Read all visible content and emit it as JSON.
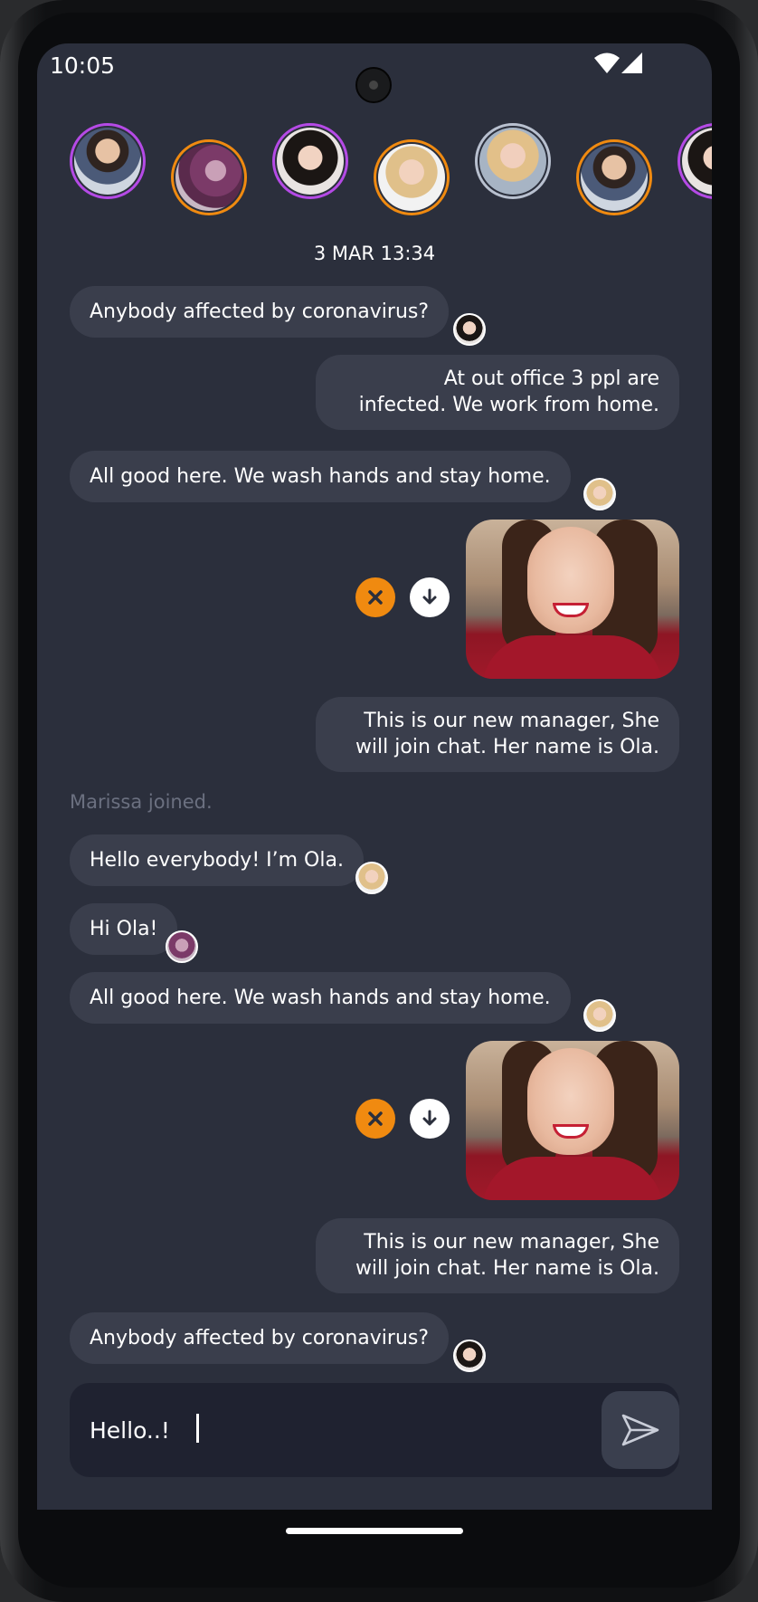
{
  "status": {
    "time": "10:05"
  },
  "stories": [
    {
      "name": "story-1",
      "ring": "purple"
    },
    {
      "name": "story-2",
      "ring": "orange"
    },
    {
      "name": "story-3",
      "ring": "purple"
    },
    {
      "name": "story-4",
      "ring": "orange"
    },
    {
      "name": "story-5",
      "ring": "silver"
    },
    {
      "name": "story-6",
      "ring": "orange"
    },
    {
      "name": "story-7",
      "ring": "purple"
    }
  ],
  "chat": {
    "date": "3 MAR 13:34",
    "m1": "Anybody affected by coronavirus?",
    "m2_line1": "At out office 3 ppl are",
    "m2_line2": "infected. We work from home.",
    "m3": "All good here. We wash hands and stay home.",
    "m4_line1": "This is our new manager, She",
    "m4_line2": "will join chat. Her name is Ola.",
    "system": "Marissa joined.",
    "m5": "Hello everybody! I’m Ola.",
    "m6": "Hi Ola!",
    "m7": "All good here. We wash hands and stay home.",
    "m8_line1": "This is our new manager, She",
    "m8_line2": "will join chat. Her name is Ola.",
    "m9": "Anybody affected by coronavirus?"
  },
  "composer": {
    "value": "Hello..!"
  },
  "colors": {
    "background": "#2b2f3c",
    "bubble": "#3a3e4c",
    "accent_orange": "#f08a10",
    "accent_purple": "#b54ae6"
  },
  "icons": {
    "send": "send-icon",
    "cancel": "close-icon",
    "download": "download-arrow-icon",
    "wifi": "wifi-icon",
    "signal": "signal-icon"
  }
}
